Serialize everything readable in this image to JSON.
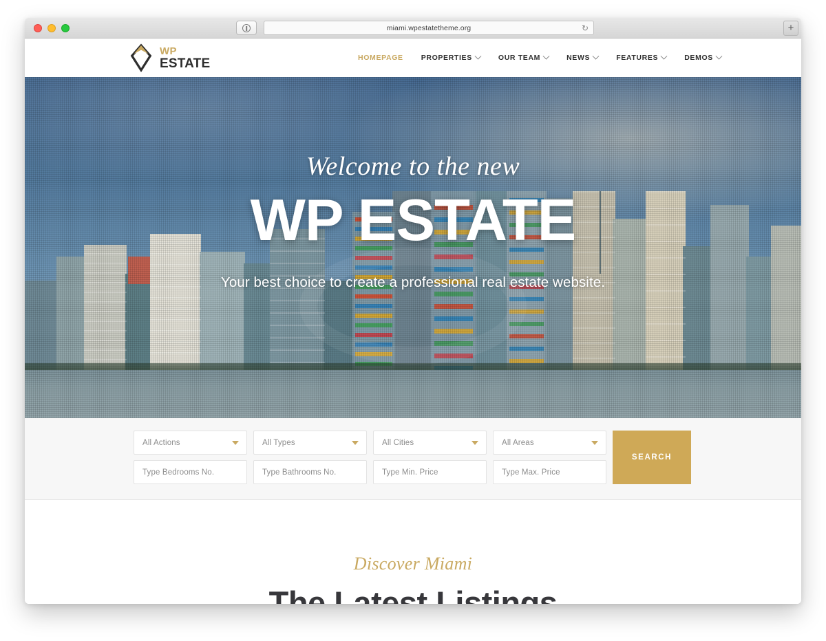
{
  "browser": {
    "url": "miami.wpestatetheme.org",
    "reload_icon": "reload-icon",
    "newtab_label": "+",
    "shield_icon": "shield-icon"
  },
  "header": {
    "logo": {
      "wp": "WP",
      "estate": "ESTATE",
      "mark_icon": "diamond-logo-icon"
    },
    "nav": [
      {
        "label": "HOMEPAGE",
        "active": true,
        "dropdown": false
      },
      {
        "label": "PROPERTIES",
        "active": false,
        "dropdown": true
      },
      {
        "label": "OUR TEAM",
        "active": false,
        "dropdown": true
      },
      {
        "label": "NEWS",
        "active": false,
        "dropdown": true
      },
      {
        "label": "FEATURES",
        "active": false,
        "dropdown": true
      },
      {
        "label": "DEMOS",
        "active": false,
        "dropdown": true
      }
    ]
  },
  "hero": {
    "welcome": "Welcome to the new",
    "title": "WP ESTATE",
    "subtitle": "Your best choice to create a professional real estate website."
  },
  "search": {
    "selects": [
      {
        "value": "All Actions"
      },
      {
        "value": "All Types"
      },
      {
        "value": "All Cities"
      },
      {
        "value": "All Areas"
      }
    ],
    "inputs": [
      {
        "placeholder": "Type Bedrooms No."
      },
      {
        "placeholder": "Type Bathrooms No."
      },
      {
        "placeholder": "Type Min. Price"
      },
      {
        "placeholder": "Type Max. Price"
      }
    ],
    "button_label": "SEARCH"
  },
  "listings": {
    "eyebrow": "Discover Miami",
    "title": "The Latest Listings"
  },
  "colors": {
    "accent_gold": "#c9a961",
    "button_gold": "#cfa957",
    "heading_dark": "#37373b"
  }
}
